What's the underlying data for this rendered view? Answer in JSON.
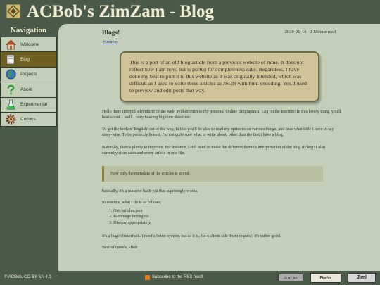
{
  "header": {
    "title": "ACBob's ZimZam - Blog"
  },
  "nav": {
    "heading": "Navigation",
    "items": [
      {
        "label": "Welcome",
        "icon": "house-icon",
        "active": false
      },
      {
        "label": "Blog",
        "icon": "document-icon",
        "active": true
      },
      {
        "label": "Projects",
        "icon": "globe-icon",
        "active": false
      },
      {
        "label": "About",
        "icon": "question-icon",
        "active": false
      },
      {
        "label": "Experimental",
        "icon": "flask-icon",
        "active": false
      },
      {
        "label": "Comics",
        "icon": "gear-icon",
        "active": false
      }
    ]
  },
  "post": {
    "title": "Blogs!",
    "meta": "2020-01-14 · 1 Minute read",
    "tag": "#archive",
    "notice": "This is a port of an old blog article from a previous website of mine. It does not reflect how I am now, but is ported for completeness sake. Regardless, I have done my best to port it to this website as it was originally intended, which was difficult as I used to write these articles as JSON with html encoding. Yes, I used to preview and edit posts that way.",
    "p1": "Hello there intrepid adventurer of the web! Wilkommen to my personal Online Biographical Log on the internet! In this lovely thing, you'll hear about... well... very boaring big dum about me.",
    "p2_a": "To get the broken 'English' out of the way, In this you'll be able to read my opinions on various things, and hear what little i have to say story-wise. To be perfectly honest, i'm not ",
    "p2_em": "quite sure",
    "p2_b": " what to write about, other than the fact i have a blog.",
    "p3_a": "Naturally, there's plenty to improve. For instance, i still need to make the different theme's interpretation of the blog styling! I also currently store ",
    "p3_strike": "each and every",
    "p3_b": " article in one file.",
    "quote": "Now only the metadata of the articles is stored.",
    "p4": "basically, it's a massive hack-job that suprisingly works.",
    "p5": "In essence, what i do is as follows;",
    "list": [
      "Get /articles.json",
      "Rummage through it",
      "Display appropriately."
    ],
    "p6": "It's a huge clusterfuck. I need a better system, but as it is, for a client-side 'form request', it's rather good.",
    "signoff_a": "Best of travels, ",
    "signoff_name": "-Bob"
  },
  "footer": {
    "copyright": "© ACBob, CC-BY-SA-4.0.",
    "rss": "Subscribe to the RSS feed!",
    "cc_badge": "cc BY SA",
    "ff_badge": "Firefox",
    "jiml_badge": "Jiml"
  },
  "colors": {
    "background": "#4a5a48",
    "panel": "#c4cfb9",
    "nav_active": "#6d6020",
    "notice": "#cfc397",
    "link": "#2b3f8a"
  }
}
